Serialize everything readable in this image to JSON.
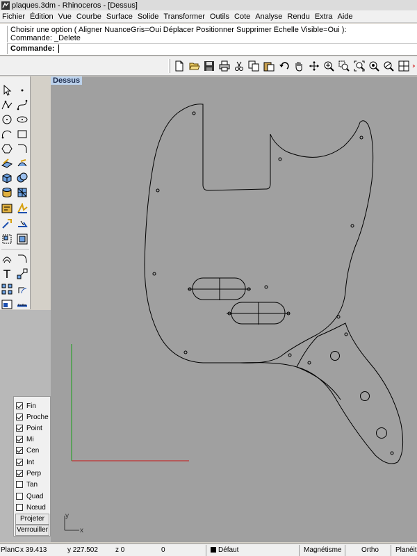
{
  "window": {
    "title": "plaques.3dm - Rhinoceros - [Dessus]"
  },
  "menu": [
    "Fichier",
    "Édition",
    "Vue",
    "Courbe",
    "Surface",
    "Solide",
    "Transformer",
    "Outils",
    "Cote",
    "Analyse",
    "Rendu",
    "Extra",
    "Aide"
  ],
  "command": {
    "history_line1": "Choisir une option ( Aligner  NuanceGris=Oui  Déplacer  Positionner  Supprimer  Échelle  Visible=Oui ):",
    "history_line2": "Commande: _Delete",
    "prompt_label": "Commande:",
    "input_value": ""
  },
  "toolbar_icons": [
    "new-file-icon",
    "open-file-icon",
    "save-icon",
    "print-icon",
    "cut-icon",
    "copy-icon",
    "paste-icon",
    "undo-icon",
    "pan-icon",
    "rotate-view-icon",
    "zoom-dynamic-icon",
    "zoom-window-icon",
    "zoom-extents-icon",
    "zoom-selected-icon",
    "zoom-all-icon",
    "four-viewports-icon"
  ],
  "viewport": {
    "label": "Dessus"
  },
  "axis_colors": {
    "x": "#c03030",
    "y": "#30a030",
    "curve": "#000000",
    "viewport_bg": "#a0a0a0"
  },
  "mini_axes": {
    "y": "y",
    "x": "x"
  },
  "osnap": {
    "items": [
      {
        "label": "Fin",
        "checked": true
      },
      {
        "label": "Proche",
        "checked": true
      },
      {
        "label": "Point",
        "checked": true
      },
      {
        "label": "Mi",
        "checked": true
      },
      {
        "label": "Cen",
        "checked": true
      },
      {
        "label": "Int",
        "checked": true
      },
      {
        "label": "Perp",
        "checked": true
      },
      {
        "label": "Tan",
        "checked": false
      },
      {
        "label": "Quad",
        "checked": false
      },
      {
        "label": "Nœud",
        "checked": false
      }
    ],
    "project_label": "Projeter",
    "lock_label": "Verrouiller"
  },
  "status": {
    "plane": "PlanC",
    "x": "x 39.413",
    "y": "y 227.502",
    "z": "z 0",
    "distance": "0",
    "layer": "Défaut",
    "snap": "Magnétisme",
    "ortho": "Ortho",
    "planar": "Planéité"
  }
}
